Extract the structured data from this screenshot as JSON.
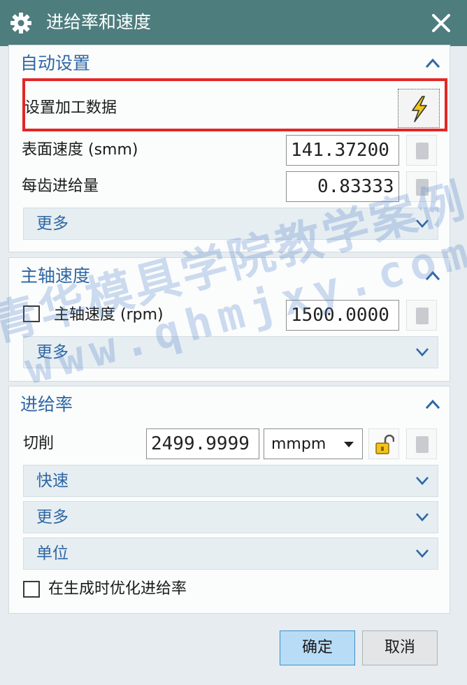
{
  "window": {
    "title": "进给率和速度",
    "title_bar_color": "#4e7d7e"
  },
  "auto_settings": {
    "section_title": "自动设置",
    "set_data_label": "设置加工数据",
    "surface_speed_label": "表面速度 (smm)",
    "surface_speed_value": "141.37200",
    "feed_per_tooth_label": "每齿进给量",
    "feed_per_tooth_value": "0.83333",
    "more_label": "更多"
  },
  "spindle": {
    "section_title": "主轴速度",
    "spindle_speed_label": "主轴速度 (rpm)",
    "spindle_speed_value": "1500.0000",
    "spindle_checked": false,
    "more_label": "更多"
  },
  "feed_rate": {
    "section_title": "进给率",
    "cut_label": "切削",
    "cut_value": "2499.9999",
    "unit_selected": "mmpm",
    "rapid_label": "快速",
    "more_label": "更多",
    "units_label": "单位",
    "optimize_label": "在生成时优化进给率",
    "optimize_checked": false
  },
  "buttons": {
    "ok": "确定",
    "cancel": "取消"
  },
  "watermark": {
    "line1": "青华模具学院教学案例",
    "line2": "www.qhmjxy.com"
  },
  "colors": {
    "section_title": "#2f67a4",
    "highlight": "#e32626",
    "ok_button": "#b8dcf5"
  }
}
